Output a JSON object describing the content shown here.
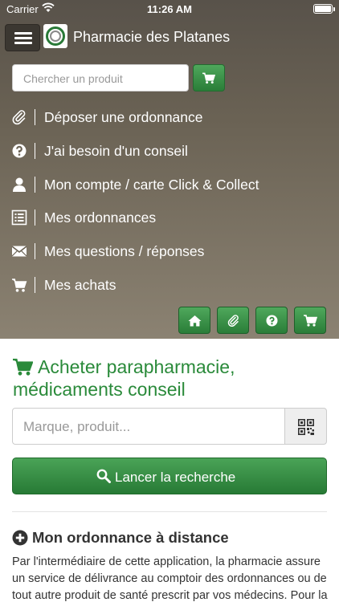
{
  "status_bar": {
    "carrier": "Carrier",
    "time": "11:26 AM"
  },
  "header": {
    "title": "Pharmacie des Platanes"
  },
  "top_search": {
    "placeholder": "Chercher un produit"
  },
  "menu": [
    {
      "icon": "paperclip-icon",
      "label": "Déposer une ordonnance"
    },
    {
      "icon": "question-circle-icon",
      "label": "J'ai besoin d'un conseil"
    },
    {
      "icon": "user-icon",
      "label": "Mon compte / carte Click & Collect"
    },
    {
      "icon": "list-icon",
      "label": "Mes ordonnances"
    },
    {
      "icon": "envelope-icon",
      "label": "Mes questions / réponses"
    },
    {
      "icon": "cart-icon",
      "label": "Mes achats"
    }
  ],
  "quick_actions": [
    "home-icon",
    "paperclip-icon",
    "question-circle-icon",
    "cart-icon"
  ],
  "shop": {
    "title_line1": "Acheter parapharmacie,",
    "title_line2": "médicaments conseil",
    "search_placeholder": "Marque, produit...",
    "search_button": "Lancer la recherche"
  },
  "prescription": {
    "title": "Mon ordonnance à distance",
    "text": "Par l'intermédiaire de cette application, la pharmacie assure un service de délivrance au comptoir des ordonnances ou de tout autre produit de santé prescrit par vos médecins. Pour la"
  },
  "colors": {
    "accent": "#2a8a3a",
    "header_bg": "#5f584d"
  }
}
